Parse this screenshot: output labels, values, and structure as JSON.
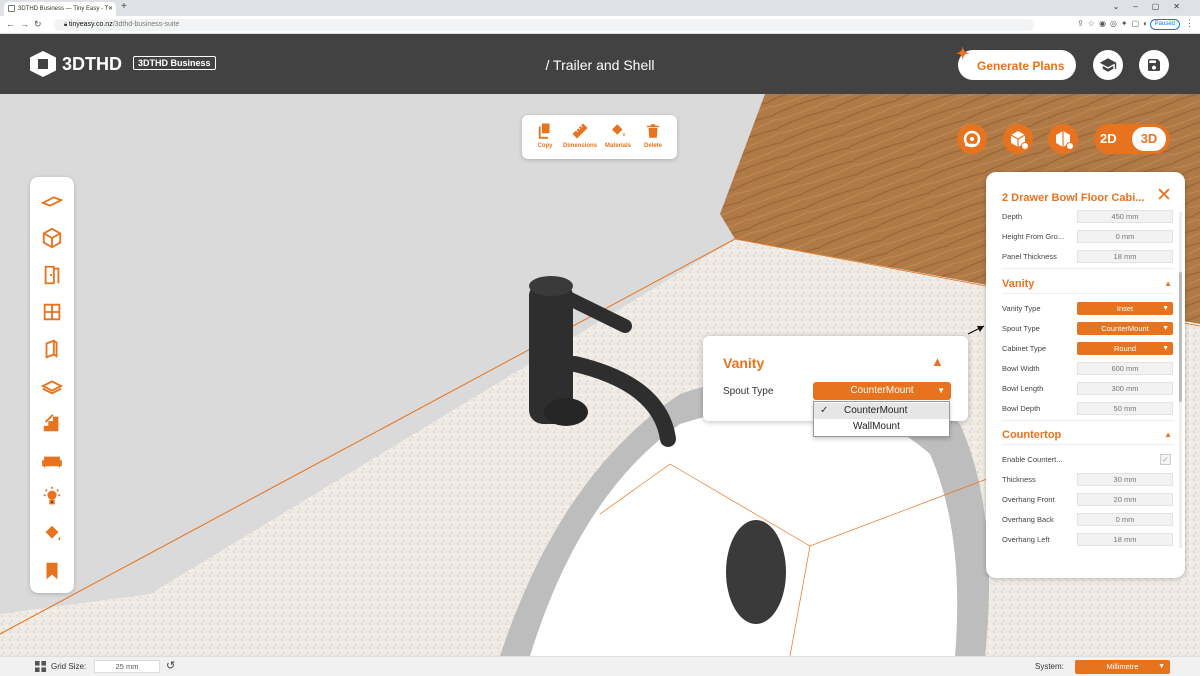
{
  "browser": {
    "tab_title": "3DTHD Business — Tiny Easy - T",
    "url_host": "tinyeasy.co.nz",
    "url_path": "/3dthd-business-suite",
    "paused_label": "Paused"
  },
  "header": {
    "logo_text": "3DTHD",
    "badge": "3DTHD Business",
    "title": "/ Trailer and Shell",
    "generate_label": "Generate Plans"
  },
  "tools": [
    {
      "label": "Copy"
    },
    {
      "label": "Dimensions"
    },
    {
      "label": "Materials"
    },
    {
      "label": "Delete"
    }
  ],
  "view_toggle": {
    "option_2d": "2D",
    "option_3d": "3D",
    "active": "3D"
  },
  "panel": {
    "title": "2 Drawer Bowl Floor Cabi...",
    "rows_top": [
      {
        "label": "Depth",
        "value": "450 mm"
      },
      {
        "label": "Height From Gro...",
        "value": "0 mm"
      },
      {
        "label": "Panel Thickness",
        "value": "18 mm"
      }
    ],
    "vanity": {
      "title": "Vanity",
      "rows": [
        {
          "label": "Vanity Type",
          "value": "Inset",
          "type": "select"
        },
        {
          "label": "Spout Type",
          "value": "CounterMount",
          "type": "select"
        },
        {
          "label": "Cabinet Type",
          "value": "Round",
          "type": "select"
        },
        {
          "label": "Bowl Width",
          "value": "600 mm",
          "type": "input"
        },
        {
          "label": "Bowl Length",
          "value": "300 mm",
          "type": "input"
        },
        {
          "label": "Bowl Depth",
          "value": "50 mm",
          "type": "input"
        }
      ]
    },
    "countertop": {
      "title": "Countertop",
      "enable_label": "Enable Countert...",
      "enable_checked": true,
      "rows": [
        {
          "label": "Thickness",
          "value": "30 mm"
        },
        {
          "label": "Overhang Front",
          "value": "20 mm"
        },
        {
          "label": "Overhang Back",
          "value": "0 mm"
        },
        {
          "label": "Overhang Left",
          "value": "18 mm"
        }
      ]
    }
  },
  "popup": {
    "title": "Vanity",
    "label": "Spout Type",
    "selected": "CounterMount",
    "options": [
      "CounterMount",
      "WallMount"
    ]
  },
  "statusbar": {
    "grid_label": "Grid Size:",
    "grid_value": "25 mm",
    "system_label": "System:",
    "system_value": "Millimetre"
  },
  "colors": {
    "accent": "#e8731f",
    "header": "#424242"
  }
}
